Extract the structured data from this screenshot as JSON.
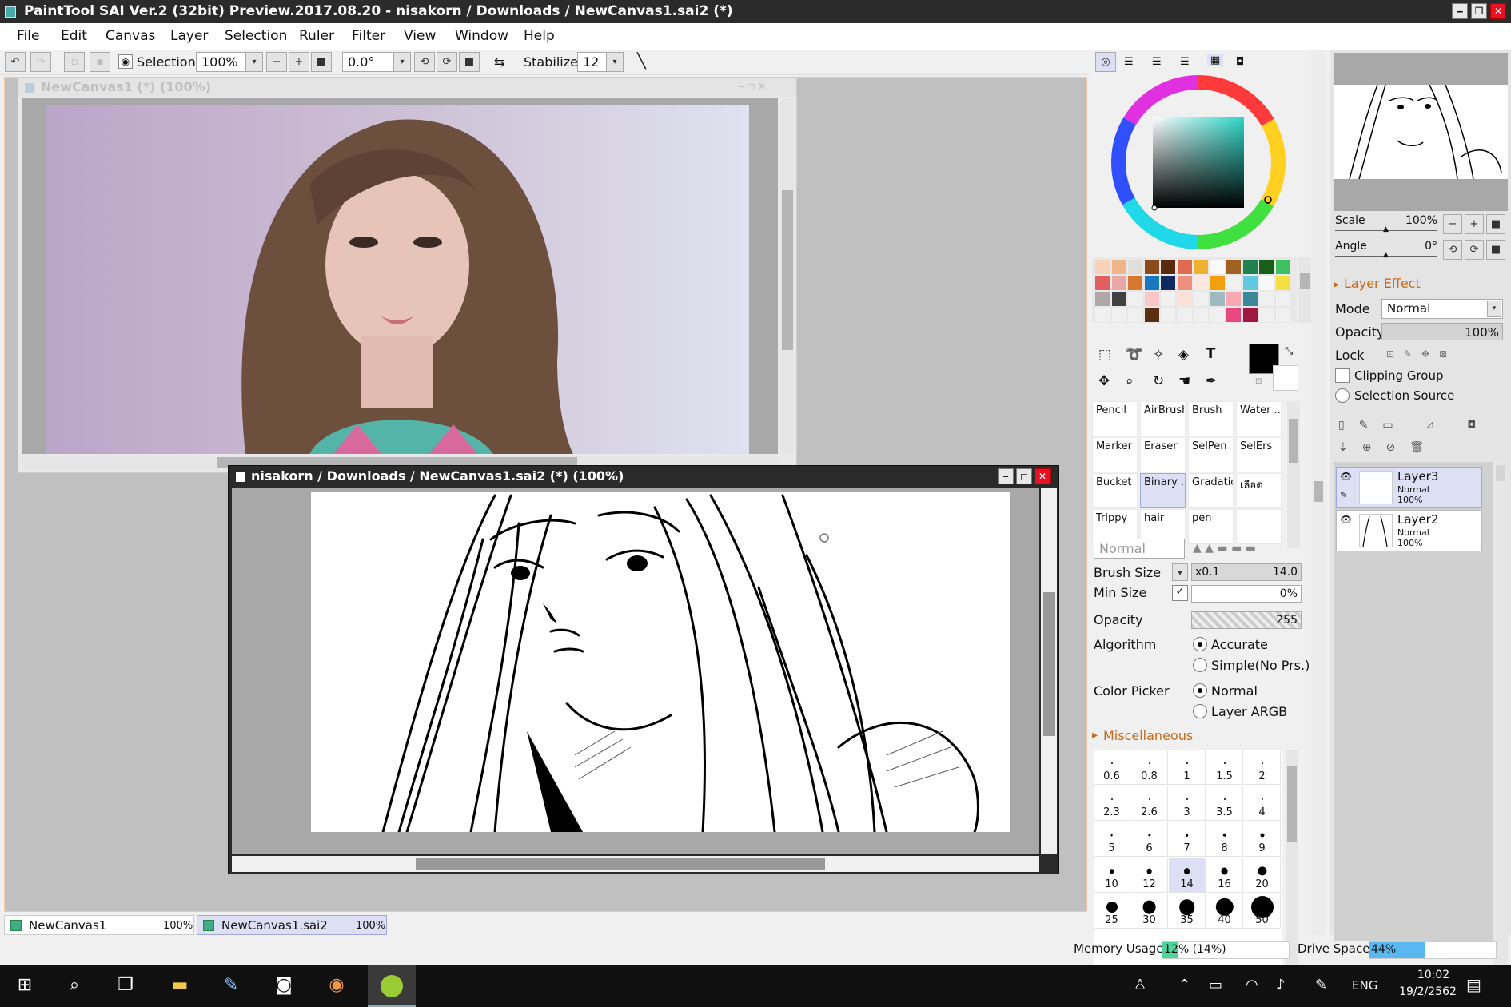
{
  "window": {
    "title": "PaintTool SAI Ver.2 (32bit) Preview.2017.08.20 - nisakorn / Downloads / NewCanvas1.sai2 (*)"
  },
  "menu": [
    "File",
    "Edit",
    "Canvas",
    "Layer",
    "Selection",
    "Ruler",
    "Filter",
    "View",
    "Window",
    "Help"
  ],
  "toolbar": {
    "selection_label": "Selection",
    "zoom": "100%",
    "rotation": "0.0°",
    "stabilizer_label": "Stabilizer",
    "stabilizer_value": "12"
  },
  "canvas1": {
    "title": "NewCanvas1 (*) (100%)"
  },
  "canvas2": {
    "title": "nisakorn / Downloads / NewCanvas1.sai2 (*) (100%)"
  },
  "tabs": [
    {
      "name": "NewCanvas1",
      "zoom": "100%"
    },
    {
      "name": "NewCanvas1.sai2",
      "zoom": "100%"
    }
  ],
  "tools": [
    [
      "Pencil",
      "AirBrush",
      "Brush",
      "Water ..."
    ],
    [
      "Marker",
      "Eraser",
      "SelPen",
      "SelErs"
    ],
    [
      "Bucket",
      "Binary ...",
      "Gradation",
      "เลือด"
    ],
    [
      "Trippy",
      "hair",
      "pen",
      ""
    ]
  ],
  "brush": {
    "blend_mode": "Normal",
    "size_label": "Brush Size",
    "size_mult": "x0.1",
    "size_value": "14.0",
    "min_label": "Min Size",
    "min_value": "0%",
    "opacity_label": "Opacity",
    "opacity_value": "255",
    "algorithm_label": "Algorithm",
    "algo_accurate": "Accurate",
    "algo_simple": "Simple(No Prs.)",
    "picker_label": "Color Picker",
    "picker_normal": "Normal",
    "picker_argb": "Layer ARGB",
    "misc_label": "Miscellaneous"
  },
  "brush_sizes": [
    "0.6",
    "0.8",
    "1",
    "1.5",
    "2",
    "2.3",
    "2.6",
    "3",
    "3.5",
    "4",
    "5",
    "6",
    "7",
    "8",
    "9",
    "10",
    "12",
    "14",
    "16",
    "20",
    "25",
    "30",
    "35",
    "40",
    "50"
  ],
  "brush_size_fractions": [
    0.012,
    0.016,
    0.02,
    0.03,
    0.04,
    0.046,
    0.052,
    0.06,
    0.07,
    0.08,
    0.1,
    0.12,
    0.14,
    0.16,
    0.18,
    0.2,
    0.24,
    0.28,
    0.32,
    0.4,
    0.5,
    0.6,
    0.7,
    0.8,
    1.0
  ],
  "navigator": {
    "scale_label": "Scale",
    "scale_value": "100%",
    "angle_label": "Angle",
    "angle_value": "0°"
  },
  "layer_props": {
    "effect_label": "Layer Effect",
    "mode_label": "Mode",
    "mode_value": "Normal",
    "opacity_label": "Opacity",
    "opacity_value": "100%",
    "lock_label": "Lock",
    "clipping_label": "Clipping Group",
    "selection_source_label": "Selection Source"
  },
  "layers": [
    {
      "name": "Layer3",
      "mode": "Normal",
      "opacity": "100%"
    },
    {
      "name": "Layer2",
      "mode": "Normal",
      "opacity": "100%"
    }
  ],
  "status": {
    "memory_label": "Memory Usage",
    "memory_value": "12% (14%)",
    "memory_fraction": 0.12,
    "drive_label": "Drive Space",
    "drive_value": "44%",
    "drive_fraction": 0.44
  },
  "taskbar": {
    "lang": "ENG",
    "time": "10:02",
    "date": "19/2/2562"
  },
  "colors": {
    "accent": "#c66a1a",
    "selected": "#dde0f5",
    "memory_bar": "#4fd49a",
    "drive_bar": "#5ab8f0"
  }
}
